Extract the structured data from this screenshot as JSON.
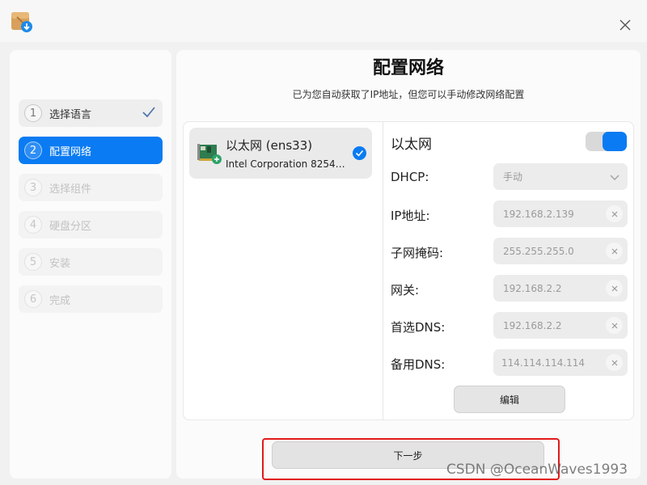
{
  "window": {
    "close_icon": "close-icon",
    "app_icon": "installer-package-icon"
  },
  "steps": [
    {
      "num": "1",
      "label": "选择语言",
      "state": "done"
    },
    {
      "num": "2",
      "label": "配置网络",
      "state": "active"
    },
    {
      "num": "3",
      "label": "选择组件",
      "state": "disabled"
    },
    {
      "num": "4",
      "label": "硬盘分区",
      "state": "disabled"
    },
    {
      "num": "5",
      "label": "安装",
      "state": "disabled"
    },
    {
      "num": "6",
      "label": "完成",
      "state": "disabled"
    }
  ],
  "main": {
    "title": "配置网络",
    "subtitle": "已为您自动获取了IP地址，但您可以手动修改网络配置"
  },
  "interface": {
    "name": "以太网 (ens33)",
    "description": "Intel Corporation 8254…",
    "selected": true
  },
  "ethernet": {
    "title": "以太网",
    "enabled": true,
    "dhcp_label": "DHCP:",
    "dhcp_value": "手动",
    "ip_label": "IP地址:",
    "ip_value": "192.168.2.139",
    "mask_label": "子网掩码:",
    "mask_value": "255.255.255.0",
    "gateway_label": "网关:",
    "gateway_value": "192.168.2.2",
    "dns1_label": "首选DNS:",
    "dns1_value": "192.168.2.2",
    "dns2_label": "备用DNS:",
    "dns2_value": "114.114.114.114",
    "edit_label": "编辑"
  },
  "footer": {
    "next_label": "下一步"
  },
  "watermark": "CSDN @OceanWaves1993",
  "colors": {
    "accent": "#0a7bf2",
    "highlight": "#e21a1a"
  }
}
